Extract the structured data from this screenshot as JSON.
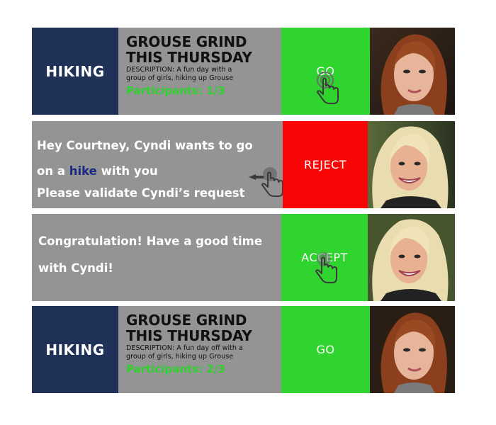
{
  "cards": [
    {
      "category": "HIKING",
      "title": "GROUSE GRIND\nTHIS THURSDAY",
      "description": "DESCRIPTION: A fun day with a\ngroup of girls, hiking up Grouse",
      "participants": "Participants: 1/3",
      "action": "GO"
    },
    {
      "line1": "Hey Courtney, Cyndi  wants to go",
      "line2_prefix": "on a ",
      "line2_highlight": "hike",
      "line2_suffix": " with you",
      "line3": " Please validate Cyndi’s request",
      "action": "REJECT"
    },
    {
      "line1": "Congratulation! Have a good time",
      "line2": "with Cyndi!",
      "action": "ACCEPT"
    },
    {
      "category": "HIKING",
      "title": "GROUSE GRIND\nTHIS THURSDAY",
      "description": "DESCRIPTION: A fun day off with a\ngroup of girls, hiking up Grouse",
      "participants": "Participants: 2/3",
      "action": "GO"
    }
  ],
  "colors": {
    "category_bg": "#1f3157",
    "card_bg": "#949494",
    "go_green": "#2fd42f",
    "reject_red": "#fa0505",
    "participants_green": "#2ed12e",
    "highlight_blue": "#1a2a80"
  },
  "icons": {
    "tap": "hand-tap-icon",
    "swipe_left": "swipe-left-hand-icon"
  }
}
